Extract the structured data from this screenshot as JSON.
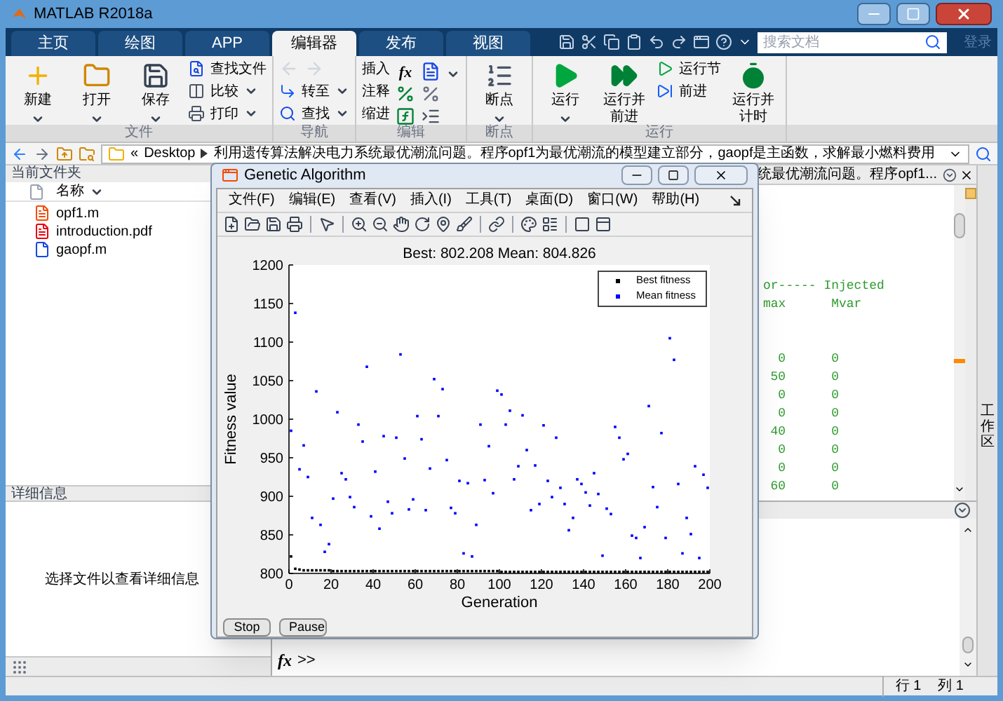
{
  "window": {
    "title": "MATLAB R2018a"
  },
  "ribbon_tabs": [
    {
      "label": "主页",
      "selected": false
    },
    {
      "label": "绘图",
      "selected": false
    },
    {
      "label": "APP",
      "selected": false
    },
    {
      "label": "编辑器",
      "selected": true
    },
    {
      "label": "发布",
      "selected": false
    },
    {
      "label": "视图",
      "selected": false
    }
  ],
  "search": {
    "placeholder": "搜索文档"
  },
  "sign_in": "登录",
  "ribbon_groups": [
    {
      "title": "文件",
      "items": [
        {
          "label": "新建",
          "kind": "large",
          "has_menu": true
        },
        {
          "label": "打开",
          "kind": "large",
          "has_menu": true
        },
        {
          "label": "保存",
          "kind": "large",
          "has_menu": true
        },
        {
          "label": "查找文件",
          "kind": "small",
          "has_menu": false
        },
        {
          "label": "比较",
          "kind": "small",
          "has_menu": true
        },
        {
          "label": "打印",
          "kind": "small",
          "has_menu": true
        }
      ]
    },
    {
      "title": "导航",
      "items": [
        {
          "label": "转至",
          "kind": "small",
          "has_menu": true
        },
        {
          "label": "查找",
          "kind": "small",
          "has_menu": true
        }
      ]
    },
    {
      "title": "编辑",
      "items": [
        {
          "label": "插入",
          "kind": "text"
        },
        {
          "label": "注释",
          "kind": "text"
        },
        {
          "label": "缩进",
          "kind": "text"
        },
        {
          "label": "fx",
          "kind": "glyph"
        }
      ]
    },
    {
      "title": "断点",
      "items": [
        {
          "label": "断点",
          "kind": "large",
          "has_menu": true
        }
      ]
    },
    {
      "title": "运行",
      "items": [
        {
          "label": "运行",
          "kind": "large",
          "has_menu": true
        },
        {
          "label": "运行并前进",
          "kind": "large",
          "has_menu": false
        },
        {
          "label": "运行节",
          "kind": "small",
          "has_menu": false
        },
        {
          "label": "前进",
          "kind": "small",
          "has_menu": false
        },
        {
          "label": "运行并计时",
          "kind": "large",
          "has_menu": false
        }
      ]
    }
  ],
  "address_bar": {
    "prefix": "«",
    "crumbs": [
      "Desktop",
      "利用遗传算法解决电力系统最优潮流问题。程序opf1为最优潮流的模型建立部分，gaopf是主函数，求解最小燃料费用"
    ]
  },
  "current_folder": {
    "title": "当前文件夹",
    "column": "名称",
    "files": [
      {
        "name": "opf1.m",
        "kind": "script"
      },
      {
        "name": "introduction.pdf",
        "kind": "pdf"
      },
      {
        "name": "gaopf.m",
        "kind": "function"
      }
    ]
  },
  "details": {
    "title": "详细信息",
    "message": "选择文件以查看详细信息"
  },
  "editor": {
    "tab_title": "统最优潮流问题。程序opf1...",
    "header_lines": [
      "or----- Injected",
      "max      Mvar"
    ],
    "rows": [
      [
        "0",
        "0"
      ],
      [
        "50",
        "0"
      ],
      [
        "0",
        "0"
      ],
      [
        "0",
        "0"
      ],
      [
        "40",
        "0"
      ],
      [
        "0",
        "0"
      ],
      [
        "0",
        "0"
      ],
      [
        "60",
        "0"
      ]
    ]
  },
  "command_window": {
    "prompt_icon": "fx",
    "prompt": ">>"
  },
  "side_tab": "工作区",
  "status_bar": {
    "row_label": "行",
    "row": "1",
    "col_label": "列",
    "col": "1"
  },
  "figure": {
    "title": "Genetic Algorithm",
    "menus": [
      "文件(F)",
      "编辑(E)",
      "查看(V)",
      "插入(I)",
      "工具(T)",
      "桌面(D)",
      "窗口(W)",
      "帮助(H)"
    ],
    "buttons": [
      "Stop",
      "Pause"
    ],
    "chart_data": {
      "type": "scatter",
      "title": "Best: 802.208 Mean: 804.826",
      "xlabel": "Generation",
      "ylabel": "Fitness value",
      "x": [
        1,
        3,
        5,
        7,
        9,
        11,
        13,
        15,
        17,
        19,
        21,
        23,
        25,
        27,
        29,
        31,
        33,
        35,
        37,
        39,
        41,
        43,
        45,
        47,
        49,
        51,
        53,
        55,
        57,
        59,
        61,
        63,
        65,
        67,
        69,
        71,
        73,
        75,
        77,
        79,
        81,
        83,
        85,
        87,
        89,
        91,
        93,
        95,
        97,
        99,
        101,
        103,
        105,
        107,
        109,
        111,
        113,
        115,
        117,
        119,
        121,
        123,
        125,
        127,
        129,
        131,
        133,
        135,
        137,
        139,
        141,
        143,
        145,
        147,
        149,
        151,
        153,
        155,
        157,
        159,
        161,
        163,
        165,
        167,
        169,
        171,
        173,
        175,
        177,
        179,
        181,
        183,
        185,
        187,
        189,
        191,
        193,
        195,
        197,
        199
      ],
      "series": [
        {
          "name": "Best fitness",
          "color": "#000000",
          "values": [
            822,
            806,
            805,
            804,
            804,
            804,
            804,
            804,
            804,
            804,
            803,
            803,
            803,
            803,
            803,
            803,
            803,
            803,
            803,
            803,
            803,
            803,
            803,
            803,
            803,
            803,
            803,
            803,
            803,
            803,
            803,
            803,
            803,
            803,
            803,
            803,
            803,
            803,
            803,
            803,
            803,
            803,
            803,
            803,
            803,
            803,
            803,
            803,
            803,
            803,
            802,
            802,
            802,
            802,
            802,
            802,
            802,
            802,
            802,
            802,
            802,
            802,
            802,
            802,
            802,
            802,
            802,
            802,
            802,
            802,
            802,
            802,
            802,
            802,
            802,
            802,
            802,
            802,
            802,
            802,
            802,
            802,
            802,
            802,
            802,
            802,
            802,
            802,
            802,
            802,
            802,
            802,
            802,
            802,
            802,
            802,
            802,
            802,
            802,
            802
          ]
        },
        {
          "name": "Mean fitness",
          "color": "#0000ff",
          "values": [
            985,
            1138,
            935,
            966,
            925,
            872,
            1036,
            863,
            828,
            838,
            897,
            1009,
            930,
            922,
            899,
            886,
            993,
            971,
            1068,
            874,
            932,
            858,
            978,
            893,
            878,
            976,
            1084,
            949,
            883,
            896,
            1004,
            974,
            882,
            936,
            1052,
            1004,
            1039,
            947,
            885,
            878,
            920,
            826,
            917,
            822,
            863,
            993,
            921,
            965,
            904,
            1037,
            1032,
            993,
            1011,
            922,
            939,
            1005,
            960,
            882,
            940,
            890,
            992,
            920,
            899,
            976,
            911,
            890,
            856,
            872,
            922,
            916,
            905,
            888,
            930,
            903,
            823,
            884,
            877,
            990,
            976,
            948,
            955,
            849,
            846,
            820,
            860,
            1017,
            912,
            886,
            982,
            846,
            1105,
            1077,
            916,
            826,
            872,
            851,
            939,
            820,
            928,
            911
          ]
        }
      ],
      "xlim": [
        0,
        200
      ],
      "ylim": [
        800,
        1200
      ],
      "xticks": [
        0,
        20,
        40,
        60,
        80,
        100,
        120,
        140,
        160,
        180,
        200
      ],
      "yticks": [
        800,
        850,
        900,
        950,
        1000,
        1050,
        1100,
        1150,
        1200
      ]
    }
  }
}
